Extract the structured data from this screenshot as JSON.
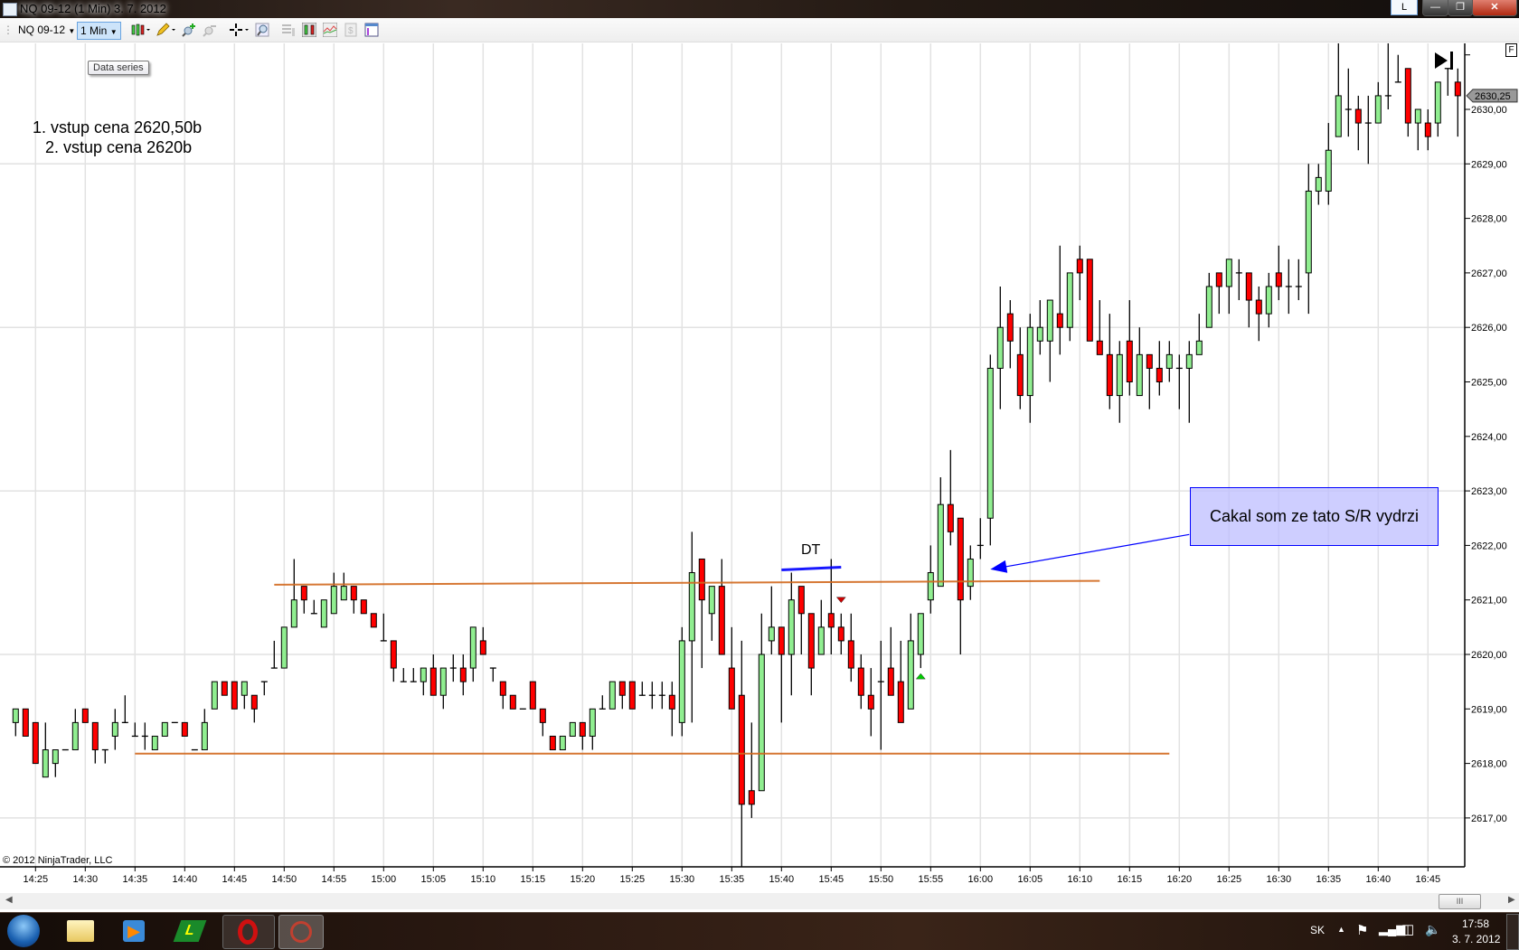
{
  "window": {
    "title": "NQ 09-12 (1 Min)  3. 7. 2012",
    "layout_button": "L"
  },
  "toolbar": {
    "instrument": "NQ 09-12",
    "interval": "1 Min",
    "tooltip": "Data series",
    "icons": [
      "chart-style-icon",
      "drawing-pencil-icon",
      "zoom-in-icon",
      "zoom-out-icon",
      "crosshair-icon",
      "magnifier-icon",
      "properties-icon",
      "bar-chart-icon",
      "indicator-icon",
      "strategy-icon",
      "data-box-icon"
    ]
  },
  "annotations": {
    "note_line1": "1. vstup cena 2620,50b",
    "note_line2": "2. vstup cena 2620b",
    "dt_label": "DT",
    "textbox": "Cakal som ze tato S/R vydrzi",
    "copyright": "© 2012 NinjaTrader, LLC",
    "f_badge": "F"
  },
  "statusbar": {
    "language": "SK",
    "time": "17:58",
    "date": "3. 7. 2012"
  },
  "chart_data": {
    "type": "candlestick",
    "instrument": "NQ 09-12",
    "interval": "1 Min",
    "last_price": "2630,25",
    "colors": {
      "up": "#90ee90",
      "down": "#ff0000",
      "outline": "#000000",
      "sr_line": "#d2691e",
      "dt_line": "#0000ff",
      "arrow": "#0000ff",
      "grid": "#e2e2e2"
    },
    "grid": true,
    "y_range": [
      2616.0,
      2631.2
    ],
    "x_range": [
      "14:21",
      "16:50"
    ],
    "x_ticks": [
      "14:25",
      "14:30",
      "14:35",
      "14:40",
      "14:45",
      "14:50",
      "14:55",
      "15:00",
      "15:05",
      "15:10",
      "15:15",
      "15:20",
      "15:25",
      "15:30",
      "15:35",
      "15:40",
      "15:45",
      "15:50",
      "15:55",
      "16:00",
      "16:05",
      "16:10",
      "16:15",
      "16:20",
      "16:25",
      "16:30",
      "16:35",
      "16:40",
      "16:45"
    ],
    "y_ticks": [
      "2617,00",
      "2618,00",
      "2619,00",
      "2620,00",
      "2621,00",
      "2622,00",
      "2623,00",
      "2624,00",
      "2625,00",
      "2626,00",
      "2627,00",
      "2628,00",
      "2629,00",
      "2630,00"
    ],
    "y_tick_values": [
      2617,
      2618,
      2619,
      2620,
      2621,
      2622,
      2623,
      2624,
      2625,
      2626,
      2627,
      2628,
      2629,
      2630
    ],
    "y_grid_values": [
      2617,
      2620,
      2623,
      2626,
      2629
    ],
    "candles_ohlc": [
      [
        "14:23",
        2618.75,
        2619,
        2618.5,
        2619
      ],
      [
        "14:24",
        2619,
        2619,
        2618.5,
        2618.5
      ],
      [
        "14:25",
        2618.75,
        2618.75,
        2618,
        2618
      ],
      [
        "14:26",
        2617.75,
        2618.75,
        2617.75,
        2618.25
      ],
      [
        "14:27",
        2618,
        2618.25,
        2617.75,
        2618.25
      ],
      [
        "14:28",
        2618.25,
        2618.25,
        2618.25,
        2618.25
      ],
      [
        "14:29",
        2618.25,
        2619,
        2618.25,
        2618.75
      ],
      [
        "14:30",
        2619,
        2619,
        2618.75,
        2618.75
      ],
      [
        "14:31",
        2618.75,
        2618.75,
        2618,
        2618.25
      ],
      [
        "14:32",
        2618.25,
        2618.25,
        2618,
        2618.25
      ],
      [
        "14:33",
        2618.5,
        2619,
        2618.25,
        2618.75
      ],
      [
        "14:34",
        2618.75,
        2619.25,
        2618.75,
        2618.75
      ],
      [
        "14:35",
        2618.5,
        2618.75,
        2618.5,
        2618.5
      ],
      [
        "14:36",
        2618.5,
        2618.75,
        2618.25,
        2618.5
      ],
      [
        "14:37",
        2618.25,
        2618.5,
        2618.25,
        2618.5
      ],
      [
        "14:38",
        2618.5,
        2618.75,
        2618.5,
        2618.75
      ],
      [
        "14:39",
        2618.75,
        2618.75,
        2618.75,
        2618.75
      ],
      [
        "14:40",
        2618.75,
        2618.75,
        2618.5,
        2618.5
      ],
      [
        "14:41",
        2618.25,
        2618.25,
        2618.25,
        2618.25
      ],
      [
        "14:42",
        2618.25,
        2619,
        2618.25,
        2618.75
      ],
      [
        "14:43",
        2619,
        2619.5,
        2619,
        2619.5
      ],
      [
        "14:44",
        2619.5,
        2619.5,
        2619.25,
        2619.25
      ],
      [
        "14:45",
        2619.5,
        2619.5,
        2619,
        2619
      ],
      [
        "14:46",
        2619.25,
        2619.5,
        2619,
        2619.5
      ],
      [
        "14:47",
        2619.25,
        2619.25,
        2618.75,
        2619
      ],
      [
        "14:48",
        2619.5,
        2619.5,
        2619.25,
        2619.5
      ],
      [
        "14:49",
        2619.75,
        2620.25,
        2619.75,
        2619.75
      ],
      [
        "14:50",
        2619.75,
        2620.5,
        2619.75,
        2620.5
      ],
      [
        "14:51",
        2620.5,
        2621.75,
        2620.5,
        2621
      ],
      [
        "14:52",
        2621.25,
        2621.25,
        2620.75,
        2621
      ],
      [
        "14:53",
        2620.75,
        2621,
        2620.75,
        2620.75
      ],
      [
        "14:54",
        2620.5,
        2621,
        2620.5,
        2621
      ],
      [
        "14:55",
        2620.75,
        2621.5,
        2620.75,
        2621.25
      ],
      [
        "14:56",
        2621,
        2621.5,
        2621,
        2621.25
      ],
      [
        "14:57",
        2621.25,
        2621.25,
        2620.75,
        2621
      ],
      [
        "14:58",
        2621,
        2621,
        2620.75,
        2620.75
      ],
      [
        "14:59",
        2620.75,
        2620.75,
        2620.5,
        2620.5
      ],
      [
        "15:00",
        2620.25,
        2620.75,
        2620.25,
        2620.25
      ],
      [
        "15:01",
        2620.25,
        2620.25,
        2619.5,
        2619.75
      ],
      [
        "15:02",
        2619.5,
        2619.75,
        2619.5,
        2619.5
      ],
      [
        "15:03",
        2619.5,
        2619.75,
        2619.5,
        2619.5
      ],
      [
        "15:04",
        2619.5,
        2619.75,
        2619.25,
        2619.75
      ],
      [
        "15:05",
        2619.75,
        2620,
        2619.25,
        2619.25
      ],
      [
        "15:06",
        2619.25,
        2619.75,
        2619,
        2619.75
      ],
      [
        "15:07",
        2619.75,
        2620,
        2619.5,
        2619.75
      ],
      [
        "15:08",
        2619.75,
        2620,
        2619.25,
        2619.5
      ],
      [
        "15:09",
        2619.75,
        2620.5,
        2619.5,
        2620.5
      ],
      [
        "15:10",
        2620.25,
        2620.5,
        2620,
        2620
      ],
      [
        "15:11",
        2619.75,
        2619.75,
        2619.5,
        2619.75
      ],
      [
        "15:12",
        2619.5,
        2619.5,
        2619,
        2619.25
      ],
      [
        "15:13",
        2619.25,
        2619.25,
        2619,
        2619
      ],
      [
        "15:14",
        2619,
        2619,
        2619,
        2619
      ],
      [
        "15:15",
        2619.5,
        2619.5,
        2619,
        2619
      ],
      [
        "15:16",
        2619,
        2619,
        2618.5,
        2618.75
      ],
      [
        "15:17",
        2618.5,
        2618.5,
        2618.25,
        2618.25
      ],
      [
        "15:18",
        2618.25,
        2618.5,
        2618.25,
        2618.5
      ],
      [
        "15:19",
        2618.5,
        2618.75,
        2618.5,
        2618.75
      ],
      [
        "15:20",
        2618.75,
        2618.75,
        2618.25,
        2618.5
      ],
      [
        "15:21",
        2618.5,
        2619,
        2618.25,
        2619
      ],
      [
        "15:22",
        2619,
        2619.25,
        2619,
        2619
      ],
      [
        "15:23",
        2619,
        2619.5,
        2619,
        2619.5
      ],
      [
        "15:24",
        2619.5,
        2619.5,
        2619,
        2619.25
      ],
      [
        "15:25",
        2619.5,
        2619.5,
        2619,
        2619
      ],
      [
        "15:26",
        2619.25,
        2619.5,
        2619.25,
        2619.25
      ],
      [
        "15:27",
        2619.25,
        2619.5,
        2619,
        2619.25
      ],
      [
        "15:28",
        2619.25,
        2619.5,
        2619,
        2619.25
      ],
      [
        "15:29",
        2619.25,
        2619.5,
        2618.5,
        2619
      ],
      [
        "15:30",
        2618.75,
        2620.5,
        2618.5,
        2620.25
      ],
      [
        "15:31",
        2620.25,
        2622.25,
        2618.75,
        2621.5
      ],
      [
        "15:32",
        2621.75,
        2621.75,
        2619.75,
        2621
      ],
      [
        "15:33",
        2620.75,
        2621.25,
        2620.25,
        2621.25
      ],
      [
        "15:34",
        2621.25,
        2621.75,
        2620,
        2620
      ],
      [
        "15:35",
        2619.75,
        2620.5,
        2619,
        2619
      ],
      [
        "15:36",
        2619.25,
        2620.25,
        2616,
        2617.25
      ],
      [
        "15:37",
        2617.5,
        2618.75,
        2617,
        2617.25
      ],
      [
        "15:38",
        2617.5,
        2620.75,
        2617.5,
        2620
      ],
      [
        "15:39",
        2620.25,
        2621.25,
        2620,
        2620.5
      ],
      [
        "15:40",
        2620.5,
        2620.5,
        2618.75,
        2620
      ],
      [
        "15:41",
        2620,
        2621.5,
        2619.25,
        2621
      ],
      [
        "15:42",
        2621.25,
        2621.25,
        2620,
        2620.75
      ],
      [
        "15:43",
        2620.75,
        2620.75,
        2619.25,
        2619.75
      ],
      [
        "15:44",
        2620,
        2621,
        2620,
        2620.5
      ],
      [
        "15:45",
        2620.75,
        2621.75,
        2620,
        2620.5
      ],
      [
        "15:46",
        2620.5,
        2620.75,
        2620,
        2620.25
      ],
      [
        "15:47",
        2620.25,
        2620.75,
        2619.5,
        2619.75
      ],
      [
        "15:48",
        2619.75,
        2620,
        2619,
        2619.25
      ],
      [
        "15:49",
        2619.25,
        2619.75,
        2618.5,
        2619
      ],
      [
        "15:50",
        2619.5,
        2620.25,
        2618.25,
        2619.5
      ],
      [
        "15:51",
        2619.75,
        2620.5,
        2619.25,
        2619.25
      ],
      [
        "15:52",
        2619.5,
        2620.25,
        2618.75,
        2618.75
      ],
      [
        "15:53",
        2619,
        2620.75,
        2619,
        2620.25
      ],
      [
        "15:54",
        2620,
        2620.75,
        2619.75,
        2620.75
      ],
      [
        "15:55",
        2621,
        2622,
        2620.75,
        2621.5
      ],
      [
        "15:56",
        2621.25,
        2623.25,
        2621.25,
        2622.75
      ],
      [
        "15:57",
        2622.75,
        2623.75,
        2622,
        2622.25
      ],
      [
        "15:58",
        2622.5,
        2622.5,
        2620,
        2621
      ],
      [
        "15:59",
        2621.25,
        2622,
        2621,
        2621.75
      ],
      [
        "16:00",
        2622,
        2622.5,
        2621.75,
        2622
      ],
      [
        "16:01",
        2622.5,
        2625.5,
        2622,
        2625.25
      ],
      [
        "16:02",
        2625.25,
        2626.75,
        2624.5,
        2626
      ],
      [
        "16:03",
        2626.25,
        2626.5,
        2625.25,
        2625.75
      ],
      [
        "16:04",
        2625.5,
        2626,
        2624.5,
        2624.75
      ],
      [
        "16:05",
        2624.75,
        2626.25,
        2624.25,
        2626
      ],
      [
        "16:06",
        2625.75,
        2626.5,
        2625.5,
        2626
      ],
      [
        "16:07",
        2625.75,
        2626.5,
        2625,
        2626.5
      ],
      [
        "16:08",
        2626.25,
        2627.5,
        2625.5,
        2626
      ],
      [
        "16:09",
        2626,
        2627,
        2625.75,
        2627
      ],
      [
        "16:10",
        2627.25,
        2627.5,
        2626.5,
        2627
      ],
      [
        "16:11",
        2627.25,
        2627.25,
        2625.75,
        2625.75
      ],
      [
        "16:12",
        2625.75,
        2626.5,
        2625.5,
        2625.5
      ],
      [
        "16:13",
        2625.5,
        2626.25,
        2624.5,
        2624.75
      ],
      [
        "16:14",
        2624.75,
        2625.75,
        2624.25,
        2625.5
      ],
      [
        "16:15",
        2625.75,
        2626.5,
        2624.75,
        2625
      ],
      [
        "16:16",
        2624.75,
        2626,
        2624.75,
        2625.5
      ],
      [
        "16:17",
        2625.5,
        2625.5,
        2624.5,
        2625.25
      ],
      [
        "16:18",
        2625.25,
        2625.75,
        2624.75,
        2625
      ],
      [
        "16:19",
        2625.25,
        2625.75,
        2625,
        2625.5
      ],
      [
        "16:20",
        2625.25,
        2625.5,
        2624.5,
        2625.25
      ],
      [
        "16:21",
        2625.25,
        2625.75,
        2624.25,
        2625.5
      ],
      [
        "16:22",
        2625.5,
        2626.25,
        2625.5,
        2625.75
      ],
      [
        "16:23",
        2626,
        2627,
        2626,
        2626.75
      ],
      [
        "16:24",
        2627,
        2627,
        2626.25,
        2626.75
      ],
      [
        "16:25",
        2626.75,
        2627.25,
        2626.25,
        2627.25
      ],
      [
        "16:26",
        2627,
        2627.25,
        2626.5,
        2627
      ],
      [
        "16:27",
        2627,
        2627,
        2626,
        2626.5
      ],
      [
        "16:28",
        2626.5,
        2626.75,
        2625.75,
        2626.25
      ],
      [
        "16:29",
        2626.25,
        2627,
        2626,
        2626.75
      ],
      [
        "16:30",
        2627,
        2627.5,
        2626.5,
        2626.75
      ],
      [
        "16:31",
        2626.75,
        2627.25,
        2626.25,
        2626.75
      ],
      [
        "16:32",
        2626.75,
        2627.25,
        2626.5,
        2626.75
      ],
      [
        "16:33",
        2627,
        2629,
        2626.25,
        2628.5
      ],
      [
        "16:34",
        2628.5,
        2629,
        2628.25,
        2628.75
      ],
      [
        "16:35",
        2628.5,
        2629.75,
        2628.25,
        2629.25
      ],
      [
        "16:36",
        2629.5,
        2631.25,
        2629.5,
        2630.25
      ],
      [
        "16:37",
        2630,
        2630.75,
        2629.5,
        2630
      ],
      [
        "16:38",
        2630,
        2630.25,
        2629.25,
        2629.75
      ],
      [
        "16:39",
        2629.75,
        2630.25,
        2629,
        2629.75
      ],
      [
        "16:40",
        2629.75,
        2630.5,
        2629.75,
        2630.25
      ],
      [
        "16:41",
        2630.25,
        2631.25,
        2630,
        2630.25
      ],
      [
        "16:42",
        2630.5,
        2631,
        2630.5,
        2630.5
      ],
      [
        "16:43",
        2630.75,
        2630.75,
        2629.5,
        2629.75
      ],
      [
        "16:44",
        2629.75,
        2630,
        2629.25,
        2630
      ],
      [
        "16:45",
        2629.75,
        2630,
        2629.25,
        2629.5
      ],
      [
        "16:46",
        2629.75,
        2630.5,
        2629.5,
        2630.5
      ],
      [
        "16:47",
        2630.75,
        2630.75,
        2630.25,
        2630.75
      ],
      [
        "16:48",
        2630.5,
        2630.75,
        2629.5,
        2630.25
      ]
    ],
    "drawings": [
      {
        "kind": "sr-line-upper",
        "from": [
          "14:49",
          2621.28
        ],
        "to": [
          "16:12",
          2621.35
        ],
        "color": "#d2691e"
      },
      {
        "kind": "sr-line-lower",
        "from": [
          "14:35",
          2618.18
        ],
        "to": [
          "16:19",
          2618.18
        ],
        "color": "#d2691e"
      },
      {
        "kind": "dt-line",
        "from": [
          "15:40",
          2621.55
        ],
        "to": [
          "15:46",
          2621.6
        ],
        "color": "#0000ff"
      },
      {
        "kind": "arrow",
        "from": [
          "16:21",
          2622.2
        ],
        "to": [
          "16:01",
          2621.56
        ],
        "color": "#0000ff"
      }
    ],
    "markers": [
      {
        "type": "sell-triangle-down",
        "time": "15:46",
        "price": 2621.0,
        "color": "#cc0000"
      },
      {
        "type": "buy-triangle-up",
        "time": "15:54",
        "price": 2619.6,
        "color": "#00cc00"
      }
    ]
  }
}
